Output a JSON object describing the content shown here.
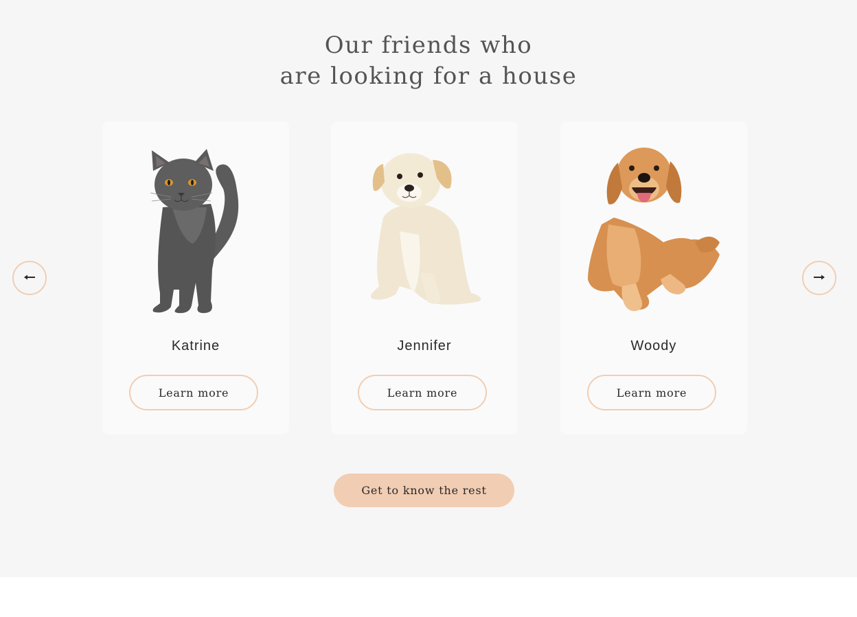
{
  "section": {
    "title_line1": "Our friends who",
    "title_line2": "are looking for a house"
  },
  "slider": {
    "prev_icon": "arrow-left-icon",
    "next_icon": "arrow-right-icon"
  },
  "pets": [
    {
      "name": "Katrine",
      "button": "Learn more",
      "image": "gray-cat"
    },
    {
      "name": "Jennifer",
      "button": "Learn more",
      "image": "cream-puppy"
    },
    {
      "name": "Woody",
      "button": "Learn more",
      "image": "golden-retriever"
    }
  ],
  "cta": {
    "label": "Get to know the rest"
  },
  "colors": {
    "accent": "#f1cdb3",
    "section_bg": "#f6f6f6",
    "card_bg": "#fafafa",
    "heading": "#545454",
    "text": "#292929"
  }
}
